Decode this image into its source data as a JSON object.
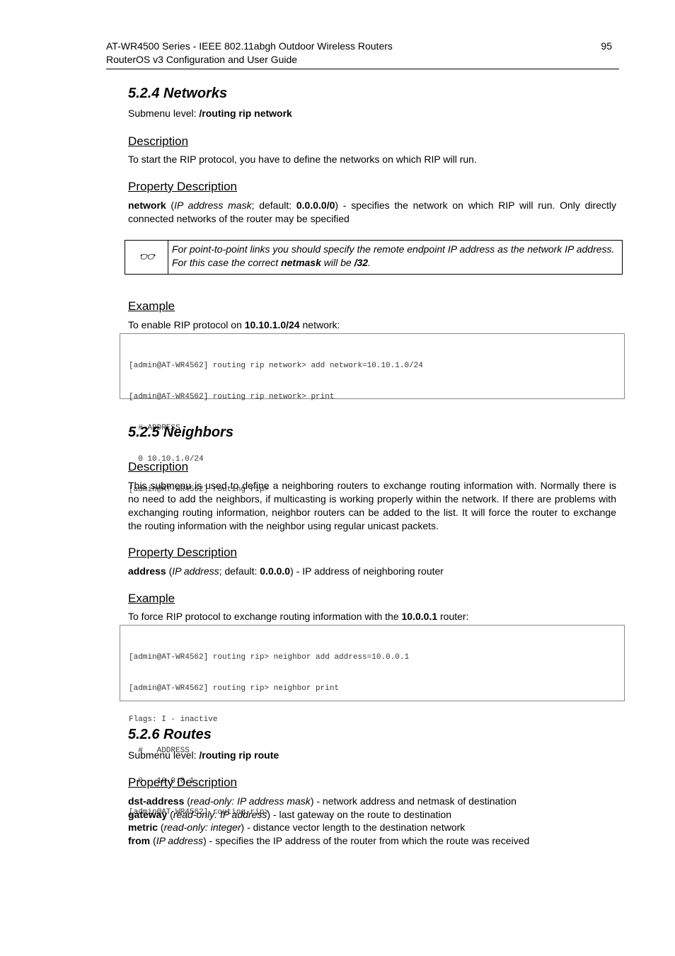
{
  "header": {
    "line1": "AT-WR4500 Series - IEEE 802.11abgh Outdoor Wireless Routers",
    "line2": "RouterOS v3 Configuration and User Guide",
    "page_number": "95"
  },
  "s524": {
    "title": "5.2.4  Networks",
    "submenu_label": "Submenu level: ",
    "submenu_value": "/routing rip network",
    "desc_heading": "Description",
    "desc_text": "To start the RIP protocol, you have to define the networks on which RIP will run.",
    "prop_heading": "Property Description",
    "prop": {
      "name": "network",
      "type": "IP address mask",
      "default_label": "; default: ",
      "default": "0.0.0.0/0",
      "text": ") - specifies the network on which RIP will run. Only directly connected networks of the router may be specified"
    },
    "note": {
      "icon": "glasses-icon",
      "pre": "For point-to-point links you should specify the remote endpoint IP address as the network IP address. For this case the correct ",
      "bold1": "netmask",
      "mid": " will be ",
      "bold2": "/32",
      "post": "."
    },
    "example_heading": "Example",
    "example_pre": "To enable RIP protocol on ",
    "example_bold": "10.10.1.0/24",
    "example_post": " network:",
    "code": [
      "[admin@AT-WR4562] routing rip network> add network=10.10.1.0/24",
      "[admin@AT-WR4562] routing rip network> print",
      "  # ADDRESS",
      "  0 10.10.1.0/24",
      "[admin@AT-WR4562] routing rip>"
    ]
  },
  "s525": {
    "title": "5.2.5  Neighbors",
    "desc_heading": "Description",
    "desc_text": "This submenu is used to define a neighboring routers to exchange routing information with. Normally there is no need to add the neighbors, if multicasting is working properly within the network. If there are problems with exchanging routing information, neighbor routers can be added to the list. It will force the router to exchange the routing information with the neighbor using regular unicast packets.",
    "prop_heading": "Property Description",
    "prop": {
      "name": "address",
      "type": "IP address",
      "default_label": "; default: ",
      "default": "0.0.0.0",
      "text": ") - IP address of neighboring router"
    },
    "example_heading": "Example",
    "example_pre": "To force RIP protocol to exchange routing information with the ",
    "example_bold": "10.0.0.1",
    "example_post": " router:",
    "code": [
      "[admin@AT-WR4562] routing rip> neighbor add address=10.0.0.1",
      "[admin@AT-WR4562] routing rip> neighbor print",
      "Flags: I - inactive",
      "  #   ADDRESS",
      "  0   10.0.0.1",
      "[admin@AT-WR4562] routing rip>"
    ]
  },
  "s526": {
    "title": "5.2.6  Routes",
    "submenu_label": "Submenu level: ",
    "submenu_value": "/routing rip route",
    "prop_heading": "Property Description",
    "props": [
      {
        "name": "dst-address",
        "type": "read-only: IP address mask",
        "text": ") - network address and netmask of destination"
      },
      {
        "name": "gateway",
        "type": "read-only: IP address",
        "text": ") - last gateway on the route to destination"
      },
      {
        "name": "metric",
        "type": "read-only: integer",
        "text": ") - distance vector length to the destination network"
      },
      {
        "name": "from",
        "type": "IP address",
        "text": ") - specifies the IP address of the router from which the route was received"
      }
    ]
  }
}
